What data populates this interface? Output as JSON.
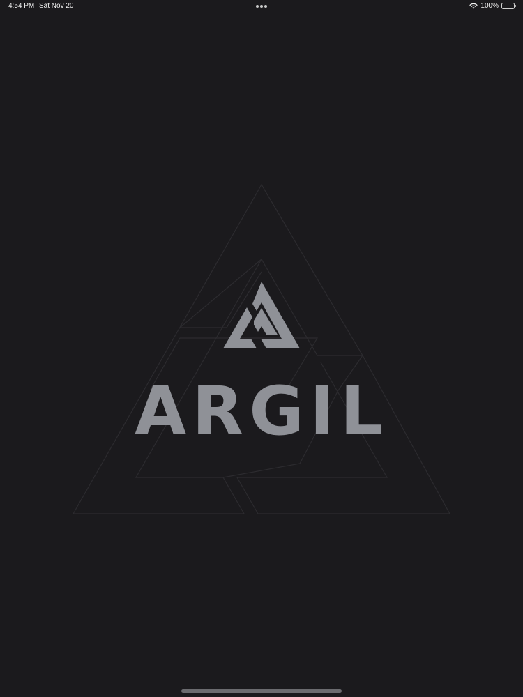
{
  "status_bar": {
    "time": "4:54 PM",
    "date": "Sat Nov 20",
    "battery_percent_label": "100%",
    "battery_level": 1.0
  },
  "splash": {
    "brand_name": "ARGIL",
    "icon": "argil-triangle-logo",
    "background_watermark_icon": "argil-triangle-watermark"
  },
  "colors": {
    "background": "#1b1a1d",
    "logo": "#8f9197",
    "watermark_stroke": "#2c2b2f"
  }
}
